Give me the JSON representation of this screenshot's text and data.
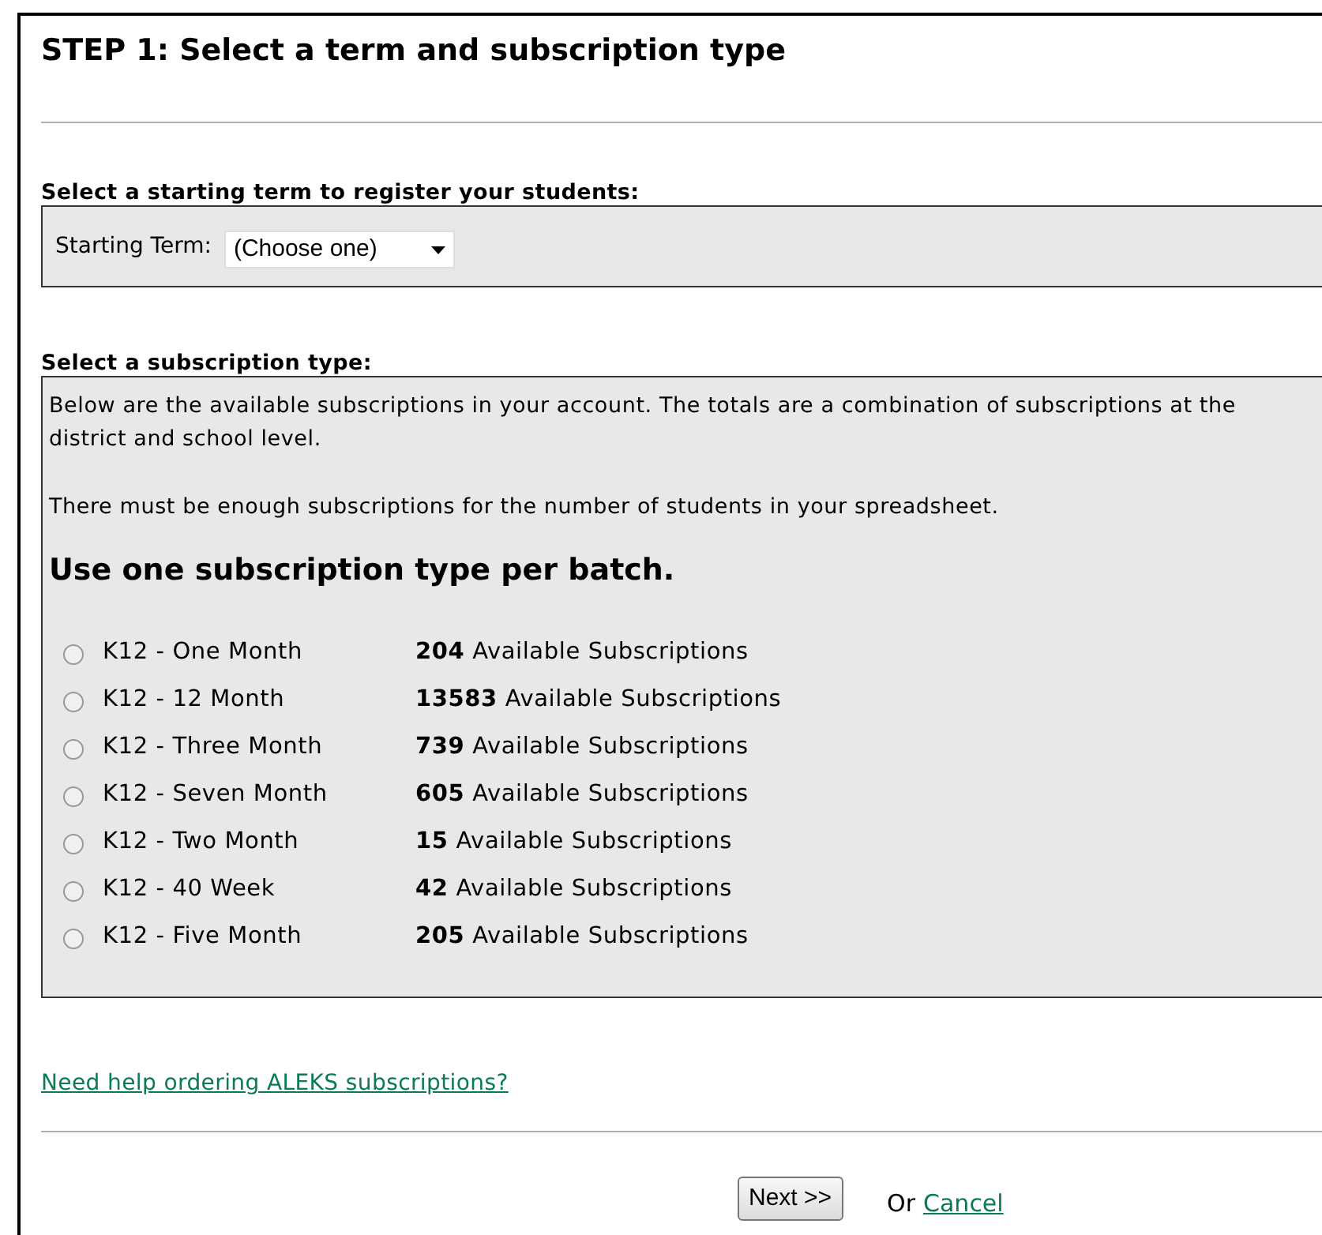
{
  "title": "STEP 1: Select a term and subscription type",
  "term_section": {
    "heading": "Select a starting term to register your students:",
    "label": "Starting Term:",
    "select_value": "(Choose one)"
  },
  "subscription_section": {
    "heading": "Select a subscription type:",
    "intro": "Below are the available subscriptions in your account. The totals are a combination of subscriptions at the district and school level.",
    "requirement": "There must be enough subscriptions for the number of students in your spreadsheet.",
    "emphasis": "Use one subscription type per batch.",
    "options": [
      {
        "name": "K12 - One Month",
        "availability": "**204** Available Subscriptions",
        "selected": false
      },
      {
        "name": "K12 - 12 Month",
        "availability": "**13583** Available Subscriptions",
        "selected": false
      },
      {
        "name": "K12 - Three Month",
        "availability": "**739** Available Subscriptions",
        "selected": false
      },
      {
        "name": "K12 - Seven Month",
        "availability": "**605** Available Subscriptions",
        "selected": false
      },
      {
        "name": "K12 - Two Month",
        "availability": "**15** Available Subscriptions",
        "selected": false
      },
      {
        "name": "K12 - 40 Week",
        "availability": "**42** Available Subscriptions",
        "selected": false
      },
      {
        "name": "K12 - Five Month",
        "availability": "**205** Available Subscriptions",
        "selected": false
      }
    ]
  },
  "help_link": "Need help ordering ALEKS subscriptions?",
  "footer": {
    "next_button": "Next >>",
    "or_text": "Or",
    "cancel_link": "Cancel"
  }
}
